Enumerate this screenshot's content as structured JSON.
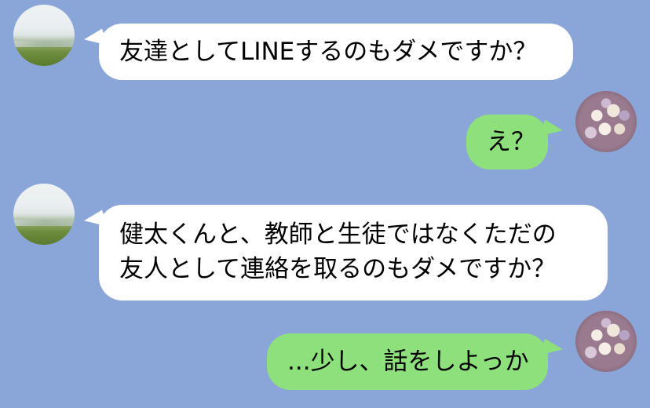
{
  "conversation": {
    "messages": [
      {
        "sender": "other",
        "lines": [
          "友達としてLINEするのもダメですか？"
        ]
      },
      {
        "sender": "me",
        "lines": [
          "え？"
        ]
      },
      {
        "sender": "other",
        "lines": [
          "健太くんと、教師と生徒ではなくただの",
          "友人として連絡を取るのもダメですか？"
        ]
      },
      {
        "sender": "me",
        "lines": [
          "...少し、話をしよっか"
        ]
      }
    ]
  },
  "colors": {
    "background": "#8aa6d8",
    "incoming_bubble": "#ffffff",
    "outgoing_bubble": "#8de07b"
  },
  "avatars": {
    "other": "landscape-photo-avatar",
    "me": "flower-bouquet-avatar"
  }
}
